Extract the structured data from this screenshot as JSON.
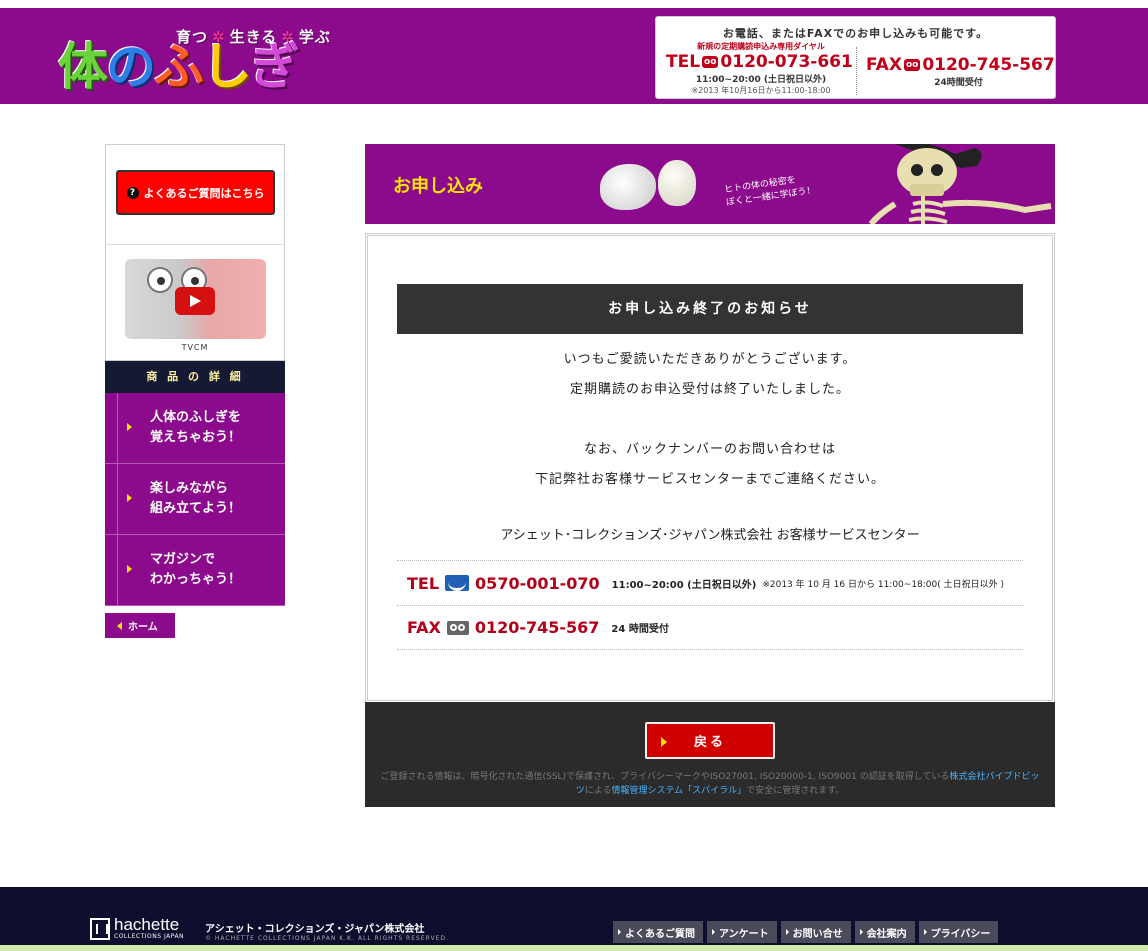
{
  "header": {
    "tagline": [
      "育つ",
      "生きる",
      "学ぶ"
    ],
    "logo_text": [
      "体",
      "の",
      "ふ",
      "し",
      "ぎ"
    ],
    "contact_title": "お電話、またはFAXでのお申し込みも可能です。",
    "tel_sub": "新規の定期購読申込み専用ダイヤル",
    "tel_label": "TEL",
    "tel_number": "0120-073-661",
    "tel_hours": "11:00~20:00 (土日祝日以外)",
    "tel_note": "※2013 年10月16日から11:00-18:00",
    "fax_label": "FAX",
    "fax_number": "0120-745-567",
    "fax_hours": "24時間受付",
    "freedial_icon": "free-dial-icon"
  },
  "sidebar": {
    "faq_label": "よくあるご質問はこちら",
    "tvcm_label": "TVCM",
    "detail_heading": "商 品 の 詳 細",
    "items": [
      {
        "line1": "人体のふしぎを",
        "line2": "覚えちゃおう！"
      },
      {
        "line1": "楽しみながら",
        "line2": "組み立てよう！"
      },
      {
        "line1": "マガジンで",
        "line2": "わかっちゃう！"
      }
    ],
    "home_label": "ホーム"
  },
  "banner": {
    "title": "お申し込み",
    "note_line1": "ヒトの体の秘密を",
    "note_line2": "ぼくと一緒に学ぼう！"
  },
  "notice": {
    "heading": "お申し込み終了のお知らせ",
    "line1": "いつもご愛読いただきありがとうございます。",
    "line2": "定期購読のお申込受付は終了いたしました。",
    "line3": "なお、バックナンバーのお問い合わせは",
    "line4": "下記弊社お客様サービスセンターまでご連絡ください。",
    "company": "アシェット･コレクションズ･ジャパン株式会社 お客様サービスセンター",
    "tel_label": "TEL",
    "tel_number": "0570-001-070",
    "tel_hours": "11:00~20:00 (土日祝日以外)",
    "tel_note": "※2013 年 10 月 16 日から 11:00~18:00( 土日祝日以外 )",
    "fax_label": "FAX",
    "fax_number": "0120-745-567",
    "fax_hours": "24 時間受付"
  },
  "action": {
    "back_label": "戻る",
    "security_pre": "ご登録される情報は、暗号化された通信(SSL)で保護され、プライバシーマークやISO27001, ISO20000-1, ISO9001 の認証を取得している",
    "security_link1": "株式会社パイプドビッツ",
    "security_mid": "による",
    "security_link2": "情報管理システム「スパイラル」",
    "security_post": "で安全に管理されます。"
  },
  "footer": {
    "brand": "hachette",
    "brand_sub": "COLLECTIONS JAPAN",
    "company": "アシェット・コレクションズ・ジャパン株式会社",
    "copyright": "© HACHETTE COLLECTIONS JAPAN K.K. ALL RIGHTS RESERVED.",
    "nav": [
      "よくあるご質問",
      "アンケート",
      "お問い合せ",
      "会社案内",
      "プライバシー"
    ]
  },
  "colors": {
    "brand_purple": "#8c0a8c",
    "accent_red": "#d10000",
    "dark_bar": "#2b2b2b",
    "footer_navy": "#0d0d2e"
  }
}
